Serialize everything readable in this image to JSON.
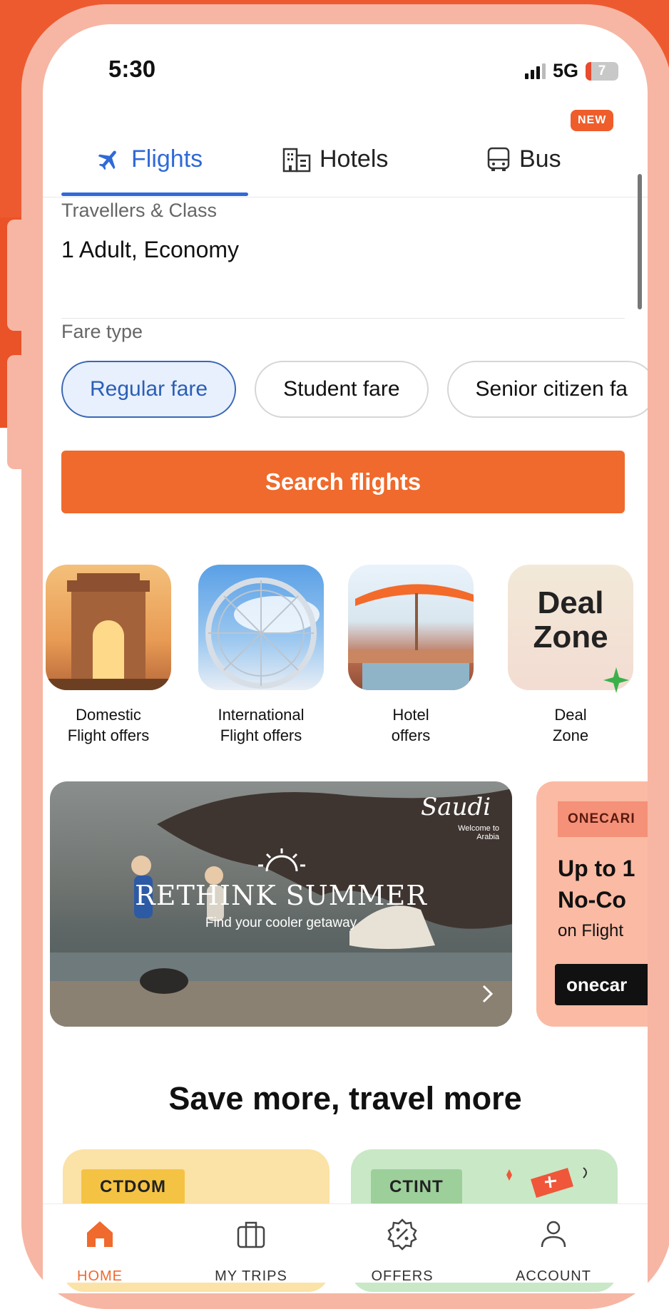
{
  "status_bar": {
    "time": "5:30",
    "network": "5G",
    "battery": "7"
  },
  "tabs": [
    {
      "label": "Flights",
      "active": true
    },
    {
      "label": "Hotels",
      "active": false
    },
    {
      "label": "Bus",
      "active": false,
      "badge": "NEW"
    }
  ],
  "travellers": {
    "label": "Travellers & Class",
    "value": "1 Adult, Economy"
  },
  "fare_type": {
    "label": "Fare type",
    "options": [
      {
        "label": "Regular fare",
        "selected": true
      },
      {
        "label": "Student fare",
        "selected": false
      },
      {
        "label": "Senior citizen fa",
        "selected": false
      }
    ]
  },
  "search_button": "Search flights",
  "offer_tiles": [
    {
      "line1": "Domestic",
      "line2": "Flight offers"
    },
    {
      "line1": "International",
      "line2": "Flight offers"
    },
    {
      "line1": "Hotel",
      "line2": "offers"
    },
    {
      "line1": "Deal",
      "line2": "Zone",
      "tile_text_1": "Deal",
      "tile_text_2": "Zone"
    }
  ],
  "banner_saudi": {
    "logo": "Saudi",
    "logo_sub": "Welcome to Arabia",
    "headline": "RETHINK SUMMER",
    "subline": "Find your cooler getaway"
  },
  "banner_onecard": {
    "tag": "ONECARI",
    "line1": "Up to 1",
    "line2": "No-Co",
    "line3": "on Flight",
    "brand": "onecar"
  },
  "section_title": "Save more, travel more",
  "coupons": [
    {
      "code": "CTDOM"
    },
    {
      "code": "CTINT"
    }
  ],
  "bottom_nav": [
    {
      "label": "HOME",
      "active": true
    },
    {
      "label": "MY TRIPS",
      "active": false
    },
    {
      "label": "OFFERS",
      "active": false
    },
    {
      "label": "ACCOUNT",
      "active": false
    }
  ],
  "colors": {
    "accent_orange": "#ef6a2c",
    "active_blue": "#2f6ad8",
    "frame_pink": "#f6b6a3",
    "background_orange": "#ee5a30"
  }
}
